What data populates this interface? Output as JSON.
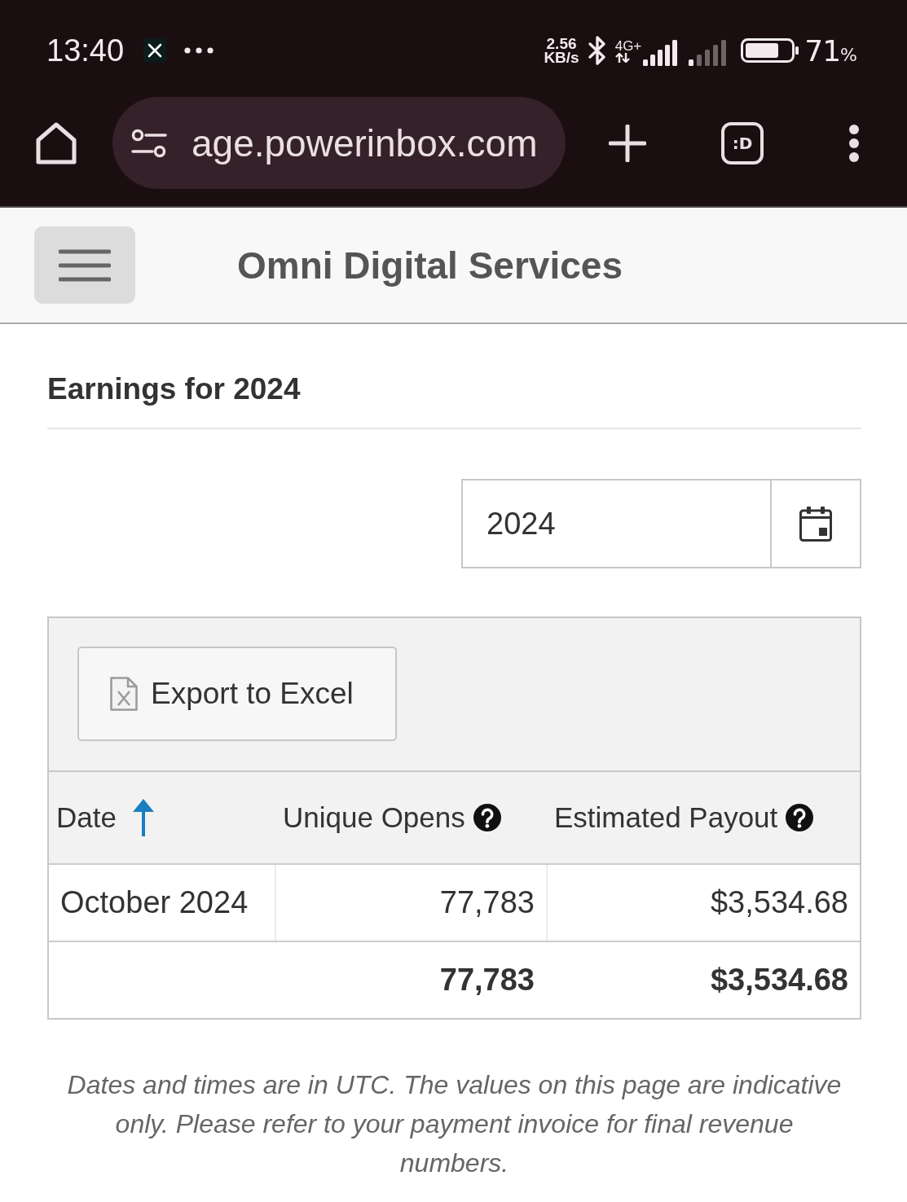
{
  "status_bar": {
    "time": "13:40",
    "net_speed_value": "2.56",
    "net_speed_unit": "KB/s",
    "network_type": "4G+",
    "battery_value": "71",
    "battery_unit": "%"
  },
  "browser": {
    "url": "age.powerinbox.com",
    "tab_switcher": ":D"
  },
  "header": {
    "title": "Omni Digital Services"
  },
  "earnings": {
    "heading": "Earnings for 2024",
    "year_picker": {
      "value": "2024"
    },
    "export_button": "Export to Excel",
    "table": {
      "columns": [
        {
          "label": "Date",
          "sorted": true,
          "help": false
        },
        {
          "label": "Unique Opens",
          "sorted": false,
          "help": true
        },
        {
          "label": "Estimated Payout",
          "sorted": false,
          "help": true
        }
      ],
      "rows": [
        {
          "cells": [
            "October 2024",
            "77,783",
            "$3,534.68"
          ]
        }
      ],
      "total": {
        "unique_opens": "77,783",
        "estimated_payout": "$3,534.68"
      }
    },
    "footnote": "Dates and times are in UTC. The values on this page are indicative only. Please refer to your payment invoice for final revenue numbers."
  }
}
